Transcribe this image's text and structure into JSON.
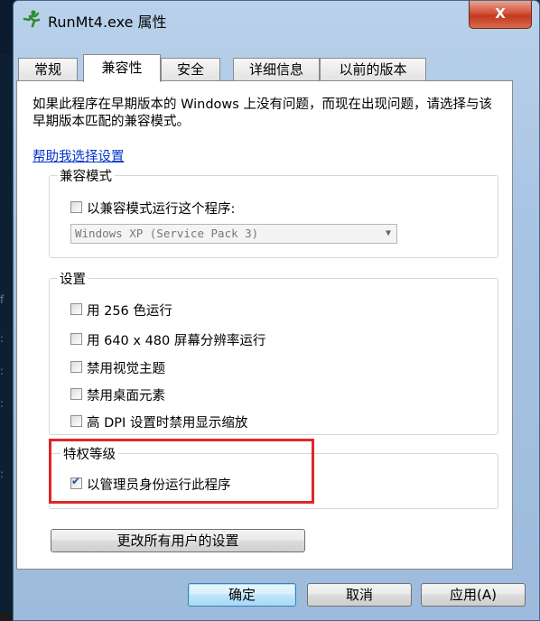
{
  "window": {
    "title": "RunMt4.exe 属性",
    "close_label": "X"
  },
  "tabs": [
    {
      "label": "常规",
      "active": false
    },
    {
      "label": "兼容性",
      "active": true
    },
    {
      "label": "安全",
      "active": false
    },
    {
      "label": "详细信息",
      "active": false
    },
    {
      "label": "以前的版本",
      "active": false
    }
  ],
  "compat": {
    "description": "如果此程序在早期版本的 Windows 上没有问题，而现在出现问题，请选择与该早期版本匹配的兼容模式。",
    "help_link": "帮助我选择设置",
    "mode_group": {
      "title": "兼容模式",
      "checkbox_label": "以兼容模式运行这个程序:",
      "checked": false,
      "select_value": "Windows XP (Service Pack 3)"
    },
    "settings_group": {
      "title": "设置",
      "options": [
        {
          "label": "用 256 色运行",
          "checked": false
        },
        {
          "label": "用 640 x 480 屏幕分辨率运行",
          "checked": false
        },
        {
          "label": "禁用视觉主题",
          "checked": false
        },
        {
          "label": "禁用桌面元素",
          "checked": false
        },
        {
          "label": "高 DPI 设置时禁用显示缩放",
          "checked": false
        }
      ]
    },
    "privilege_group": {
      "title": "特权等级",
      "checkbox_label": "以管理员身份运行此程序",
      "checked": true
    },
    "all_users_button": "更改所有用户的设置"
  },
  "footer": {
    "ok": "确定",
    "cancel": "取消",
    "apply": "应用(A)"
  },
  "colors": {
    "highlight": "#e0262a",
    "link": "#0033cc"
  }
}
